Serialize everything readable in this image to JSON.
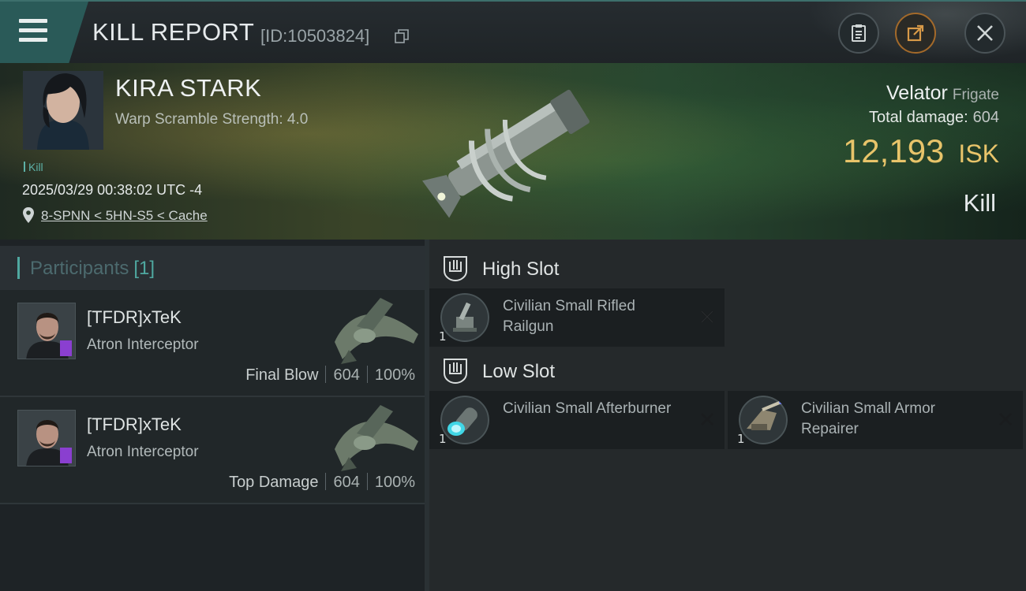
{
  "header": {
    "title": "KILL REPORT",
    "report_id": "[ID:10503824]",
    "icons": {
      "menu": "hamburger-menu-icon",
      "copy": "copy-icon",
      "clipboard": "clipboard-icon",
      "share": "share-icon",
      "close": "close-icon"
    }
  },
  "victim": {
    "name": "KIRA STARK",
    "warp_scramble": "Warp Scramble Strength: 4.0",
    "tag": "Kill",
    "timestamp": "2025/03/29 00:38:02 UTC -4",
    "location": "8-SPNN < 5HN-S5 < Cache",
    "ship_name": "Velator",
    "ship_class": "Frigate",
    "total_damage_label": "Total damage:",
    "total_damage": "604",
    "isk_value": "12,193",
    "isk_unit": "ISK",
    "result": "Kill"
  },
  "participants": {
    "title": "Participants",
    "count": "[1]",
    "rows": [
      {
        "name": "[TFDR]xTeK",
        "ship": "Atron Interceptor",
        "role": "Final Blow",
        "damage": "604",
        "percent": "100%"
      },
      {
        "name": "[TFDR]xTeK",
        "ship": "Atron Interceptor",
        "role": "Top Damage",
        "damage": "604",
        "percent": "100%"
      }
    ]
  },
  "slots": {
    "high": {
      "title": "High Slot",
      "modules": [
        {
          "qty": "1",
          "name": "Civilian Small Rifled Railgun"
        }
      ]
    },
    "low": {
      "title": "Low Slot",
      "modules": [
        {
          "qty": "1",
          "name": "Civilian Small Afterburner"
        },
        {
          "qty": "1",
          "name": "Civilian Small Armor Repairer"
        }
      ]
    }
  },
  "colors": {
    "accent": "#4fa8a0",
    "isk": "#e8c46a",
    "badge": "#8a3fd0"
  }
}
